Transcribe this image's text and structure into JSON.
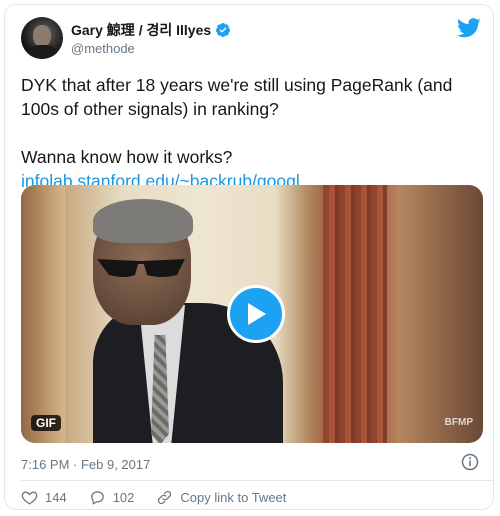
{
  "author": {
    "display_name": "Gary 鯨理 / 경리 Illyes",
    "handle": "@methode"
  },
  "tweet": {
    "line1": "DYK that after 18 years we're still using PageRank (and 100s of other signals) in ranking?",
    "line2": "Wanna know how it works?",
    "link": "infolab.stanford.edu/~backrub/googl..."
  },
  "media": {
    "badge": "GIF",
    "watermark": "BFMP"
  },
  "meta": {
    "timestamp": "7:16 PM · Feb 9, 2017"
  },
  "actions": {
    "likes": "144",
    "replies": "102",
    "copy_link_label": "Copy link to Tweet"
  },
  "colors": {
    "accent": "#1da1f2",
    "link": "#1b95e0",
    "muted": "#657786",
    "text": "#14171a"
  },
  "icons": [
    "verified-badge-icon",
    "twitter-bird-icon",
    "play-icon",
    "info-icon",
    "heart-icon",
    "reply-icon",
    "link-icon"
  ]
}
